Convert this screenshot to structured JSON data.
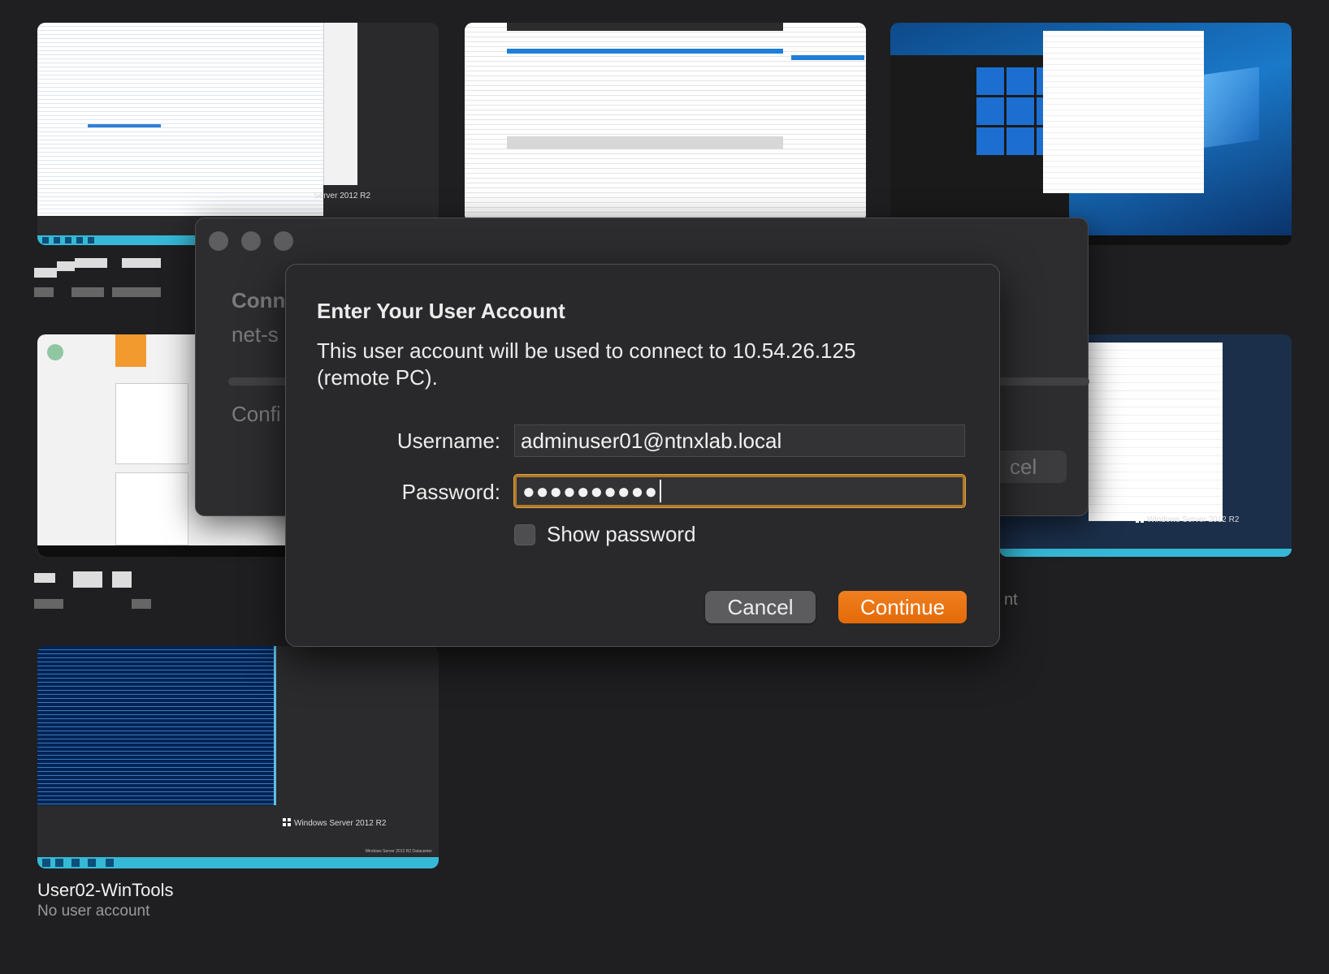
{
  "background_windows": {
    "thumb1_label": "Server 2012 R2",
    "thumb5_label": "Windows Server 2012 R2",
    "thumb6_label": "Windows Server 2012 R2",
    "thumb6_info": "Windows Server 2012 R2 Datacenter"
  },
  "machines": [
    {
      "name": "User02-WinTools",
      "account": "No user account"
    }
  ],
  "back_window": {
    "title_partial": "Conn",
    "subtitle_partial": "net-s",
    "config_partial": "Confi",
    "cancel_partial": "cel",
    "status_partial": "nt"
  },
  "dialog": {
    "heading": "Enter Your User Account",
    "description": "This user account will be used to connect to 10.54.26.125 (remote PC).",
    "username_label": "Username:",
    "username_value": "adminuser01@ntnxlab.local",
    "password_label": "Password:",
    "password_mask": "●●●●●●●●●●",
    "show_password_label": "Show password",
    "cancel_label": "Cancel",
    "continue_label": "Continue"
  },
  "colors": {
    "accent": "#e8730f",
    "focus_ring": "#b07a2a",
    "background": "#1f1f21"
  }
}
